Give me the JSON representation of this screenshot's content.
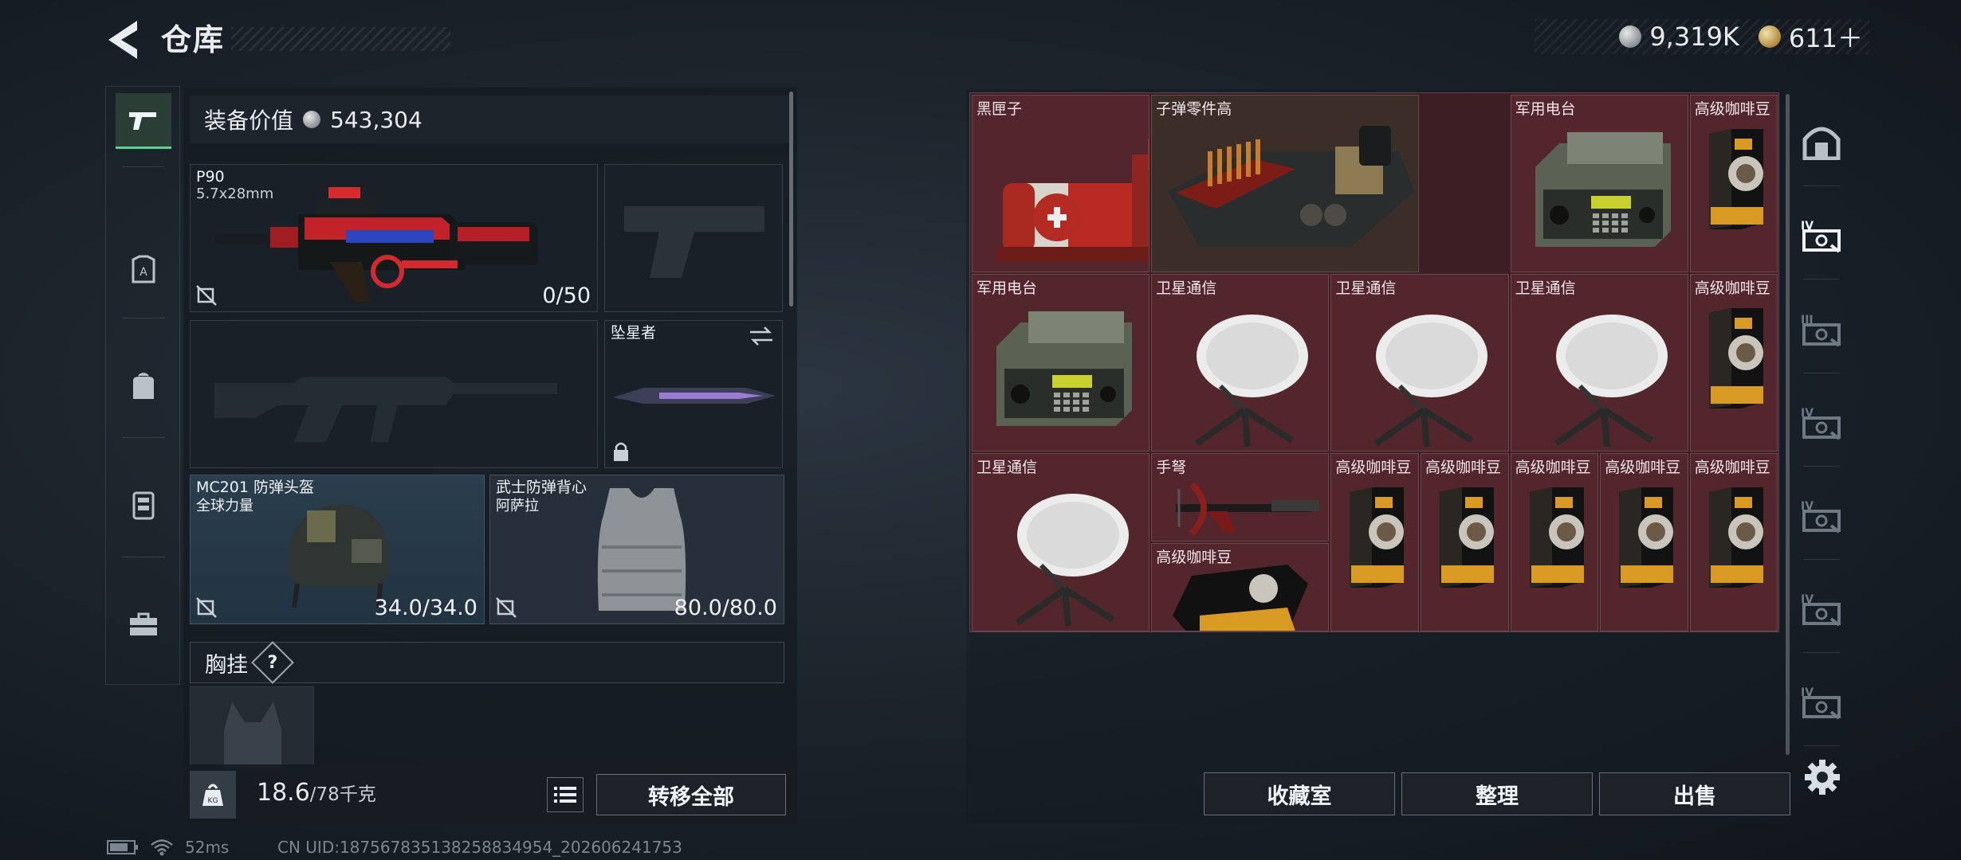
{
  "header": {
    "title": "仓库",
    "back_icon": "back-arrow-icon"
  },
  "currency": {
    "silver_value": "9,319K",
    "gold_value": "611＋",
    "silver_icon": "silver-coin-icon",
    "gold_icon": "gold-coin-icon"
  },
  "left_rail": {
    "tabs": [
      {
        "icon": "pistol-icon",
        "active": true
      },
      {
        "icon": "armor-plate-icon",
        "active": false
      },
      {
        "icon": "backpack-icon",
        "active": false
      },
      {
        "icon": "vest-rig-icon",
        "active": false
      },
      {
        "icon": "toolbox-icon",
        "active": false
      }
    ]
  },
  "loadout": {
    "equip_value_label": "装备价值",
    "equip_value": "543,304",
    "primary": {
      "name": "P90",
      "ammo_type": "5.7x28mm",
      "ammo": "0/50"
    },
    "melee": {
      "name": "坠星者"
    },
    "helmet": {
      "name": "MC201 防弹头盔",
      "brand": "全球力量",
      "durability": "34.0/34.0"
    },
    "armor": {
      "name": "武士防弹背心",
      "brand": "阿萨拉",
      "durability": "80.0/80.0"
    },
    "chest_rig_label": "胸挂",
    "help_mark": "?",
    "weight_current": "18.6",
    "weight_max": "/78千克",
    "transfer_all": "转移全部"
  },
  "storage": {
    "items": [
      {
        "label": "黑匣子",
        "art": "blackbox"
      },
      {
        "label": "子弹零件高",
        "art": "ammoparts"
      },
      {
        "label": "军用电台",
        "art": "radio"
      },
      {
        "label": "高级咖啡豆",
        "art": "coffee"
      },
      {
        "label": "军用电台",
        "art": "radio"
      },
      {
        "label": "卫星通信",
        "art": "satellite"
      },
      {
        "label": "卫星通信",
        "art": "satellite"
      },
      {
        "label": "卫星通信",
        "art": "satellite"
      },
      {
        "label": "高级咖啡豆",
        "art": "coffee"
      },
      {
        "label": "卫星通信",
        "art": "satellite"
      },
      {
        "label": "手弩",
        "art": "crossbow"
      },
      {
        "label": "高级咖啡豆",
        "art": "coffee"
      },
      {
        "label": "高级咖啡豆",
        "art": "coffee"
      },
      {
        "label": "高级咖啡豆",
        "art": "coffee"
      },
      {
        "label": "高级咖啡豆",
        "art": "coffee"
      },
      {
        "label": "高级咖啡豆",
        "art": "coffee"
      },
      {
        "label": "高级咖啡豆",
        "art": "coffeeflat"
      }
    ],
    "buttons": {
      "collection": "收藏室",
      "sort": "整理",
      "sell": "出售"
    }
  },
  "right_rail": {
    "tabs": [
      {
        "icon": "vault-icon",
        "badge": ""
      },
      {
        "icon": "storage-page-icon",
        "badge": "IV"
      },
      {
        "icon": "storage-page-icon",
        "badge": "III"
      },
      {
        "icon": "storage-page-icon",
        "badge": "IV"
      },
      {
        "icon": "storage-page-icon",
        "badge": "IV"
      },
      {
        "icon": "storage-page-icon",
        "badge": "IV"
      },
      {
        "icon": "storage-page-icon",
        "badge": "IV"
      }
    ],
    "settings_icon": "gear-icon"
  },
  "status_bar": {
    "ping": "52ms",
    "uid": "CN UID:1875678351382588349​54_202606241753"
  },
  "colors": {
    "grid_cell": "#53262d",
    "active_tab": "#59d28c",
    "background": "#1c242c"
  }
}
